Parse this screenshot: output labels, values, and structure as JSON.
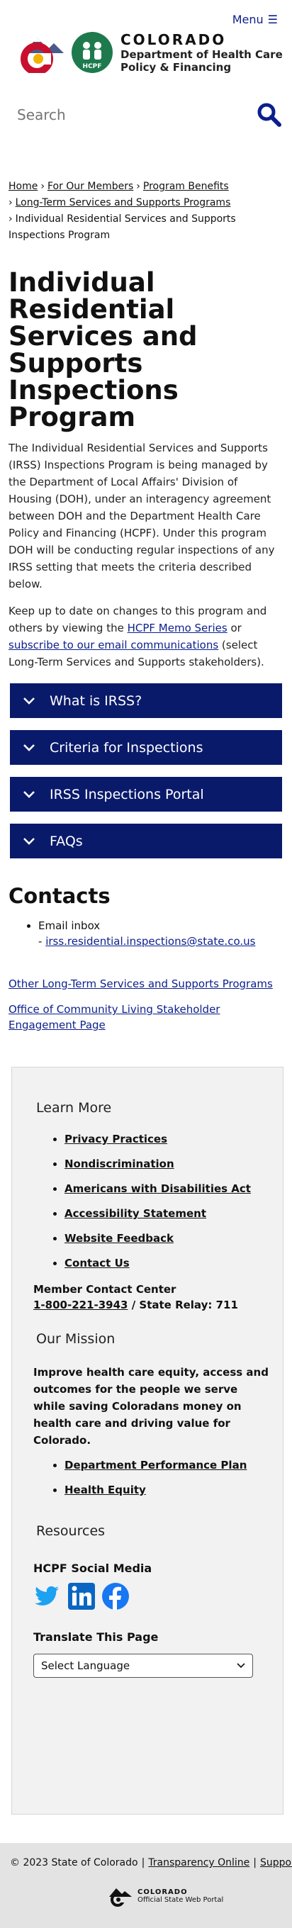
{
  "header": {
    "menu_label": "Menu",
    "logo": {
      "state": "COLORADO",
      "dept_line1": "Department of Health Care",
      "dept_line2": "Policy & Financing",
      "hcpf_badge": "HCPF"
    }
  },
  "search": {
    "placeholder": "Search"
  },
  "breadcrumb": {
    "items": [
      "Home",
      "For Our Members",
      "Program Benefits",
      "Long-Term Services and Supports Programs"
    ],
    "current": "Individual Residential Services and Supports Inspections Program"
  },
  "page": {
    "title": "Individual Residential Services and Supports Inspections Program",
    "intro_p1": "The Individual Residential Services and Supports (IRSS) Inspections Program is being managed by the Department of Local Affairs' Division of Housing (DOH), under an interagency agreement between DOH and the Department Health Care Policy and Financing (HCPF).  Under this program DOH will be conducting regular inspections of any IRSS setting that meets the criteria described below.",
    "intro_p2_a": "Keep up to date on changes to this program and others by viewing the ",
    "intro_p2_link1": "HCPF Memo Series",
    "intro_p2_b": " or ",
    "intro_p2_link2": "subscribe to our email communications",
    "intro_p2_c": " (select Long-Term Services and Supports stakeholders)."
  },
  "accordion": [
    {
      "label": "What is IRSS?"
    },
    {
      "label": "Criteria for Inspections"
    },
    {
      "label": "IRSS Inspections Portal"
    },
    {
      "label": "FAQs"
    }
  ],
  "contacts": {
    "heading": "Contacts",
    "item_label": "Email inbox",
    "email_prefix": "- ",
    "email": "irss.residential.inspections@state.co.us"
  },
  "related_links": [
    "Other Long-Term Services and Supports Programs",
    "Office of Community Living Stakeholder Engagement Page"
  ],
  "footer": {
    "learn_more_title": "Learn More",
    "learn_more_links": [
      "Privacy Practices",
      "Nondiscrimination",
      "Americans with Disabilities Act",
      "Accessibility Statement",
      "Website Feedback",
      "Contact Us"
    ],
    "member_contact_label": "Member Contact Center",
    "member_phone": "1-800-221-3943",
    "state_relay": " / State Relay: 711",
    "mission_title": "Our Mission",
    "mission_text": "Improve health care equity, access and outcomes for the people we serve while saving Coloradans money on health care and driving value for Colorado.",
    "mission_links": [
      "Department Performance Plan",
      "Health Equity"
    ],
    "resources_title": "Resources",
    "social_title": "HCPF Social Media",
    "translate_title": "Translate This Page",
    "language_select": "Select Language"
  },
  "bottom_bar": {
    "copyright": "© 2023 State of Colorado",
    "transparency": "Transparency Online",
    "support": "Support",
    "portal_name": "COLORADO",
    "portal_sub": "Official State Web Portal"
  },
  "colors": {
    "brand_navy": "#0a1a6b",
    "link_blue": "#0b1f8c",
    "co_red": "#c8102e",
    "co_gold": "#f2b300",
    "hcpf_green": "#1e7a4d"
  }
}
